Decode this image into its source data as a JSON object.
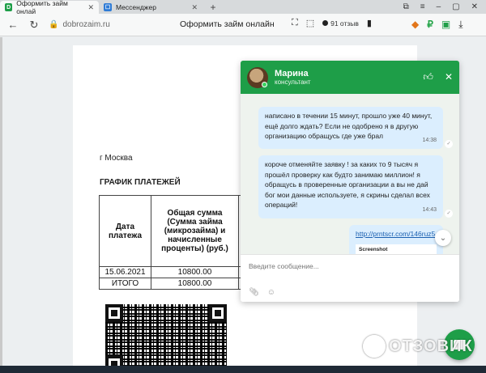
{
  "browser": {
    "tabs": [
      {
        "favicon": "D",
        "title": "Оформить займ онлай",
        "active": true
      },
      {
        "favicon": "☐",
        "title": "Мессенджер",
        "active": false
      }
    ],
    "new_tab": "+",
    "url": "dobrozaim.ru",
    "page_title": "Оформить займ онлайн",
    "reviews": "91 отзыв"
  },
  "document": {
    "city": "г Москва",
    "schedule_title": "ГРАФИК ПЛАТЕЖЕЙ",
    "table": {
      "headers": [
        "Дата платежа",
        "Общая сумма (Сумма займа (микрозайма) и начисленные проценты) (руб.)"
      ],
      "rows": [
        [
          "15.06.2021",
          "10800.00"
        ],
        [
          "ИТОГО",
          "10800.00"
        ]
      ]
    }
  },
  "chat": {
    "agent_name": "Марина",
    "agent_role": "консультант",
    "messages": [
      {
        "text": "написано в течении 15 минут, прошло уже 40 минут, ещё долго ждать? Если не одобрено я в другую организацию обращусь где уже брал",
        "time": "14:38"
      },
      {
        "text": "короче отменяйте заявку ! за каких то 9 тысяч я прошёл проверку как будто занимаю миллион! я обращусь в проверенные организации а вы не дай бог мои данные используете, я скрины сделал всех операций!",
        "time": "14:43"
      },
      {
        "link": "http://prntscr.com/146ruz5",
        "preview": "Screenshot"
      }
    ],
    "input_placeholder": "Введите сообщение..."
  },
  "watermark": "ОТЗОВИК"
}
